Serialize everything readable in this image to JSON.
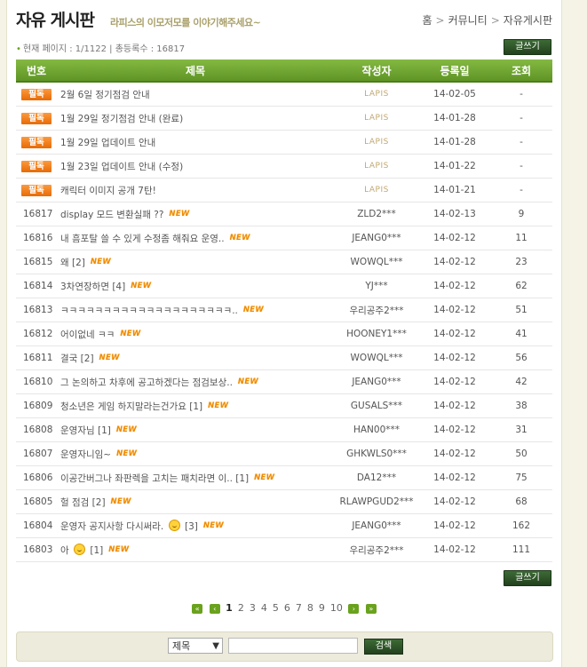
{
  "header": {
    "title": "자유 게시판",
    "subtitle": "라피스의 이모저모를 이야기해주세요~",
    "breadcrumb": [
      "홈",
      "커뮤니티",
      "자유게시판"
    ],
    "separator": ">"
  },
  "info": "현재 페이지 : 1/1122 | 총등록수 : 16817",
  "write_label": "글쓰기",
  "columns": [
    "번호",
    "제목",
    "작성자",
    "등록일",
    "조회"
  ],
  "notice_label": "필독",
  "new_label": "NEW",
  "notices": [
    {
      "title": "2월 6일 정기점검 안내",
      "author": "LAPIS",
      "date": "14-02-05",
      "views": "-"
    },
    {
      "title": "1월 29일 정기점검 안내 (완료)",
      "author": "LAPIS",
      "date": "14-01-28",
      "views": "-"
    },
    {
      "title": "1월 29일 업데이트 안내",
      "author": "LAPIS",
      "date": "14-01-28",
      "views": "-"
    },
    {
      "title": "1월 23일 업데이트 안내 (수정)",
      "author": "LAPIS",
      "date": "14-01-22",
      "views": "-"
    },
    {
      "title": "캐릭터 이미지 공개 7탄!",
      "author": "LAPIS",
      "date": "14-01-21",
      "views": "-"
    }
  ],
  "posts": [
    {
      "num": "16817",
      "title": "display 모드 변환실패 ??",
      "comments": "",
      "author": "ZLD2***",
      "date": "14-02-13",
      "views": "9"
    },
    {
      "num": "16816",
      "title": "내 흠포탈 쓸 수 있게 수정좀 해줘요 운영..",
      "comments": "",
      "author": "JEANG0***",
      "date": "14-02-12",
      "views": "11"
    },
    {
      "num": "16815",
      "title": "왜",
      "comments": "[2]",
      "author": "WOWQL***",
      "date": "14-02-12",
      "views": "23"
    },
    {
      "num": "16814",
      "title": "3차연장하면",
      "comments": "[4]",
      "author": "YJ***",
      "date": "14-02-12",
      "views": "62"
    },
    {
      "num": "16813",
      "title": "ㅋㅋㅋㅋㅋㅋㅋㅋㅋㅋㅋㅋㅋㅋㅋㅋㅋㅋㅋㅋ..",
      "comments": "",
      "author": "우리공주2***",
      "date": "14-02-12",
      "views": "51"
    },
    {
      "num": "16812",
      "title": "어이없네 ㅋㅋ",
      "comments": "",
      "author": "HOONEY1***",
      "date": "14-02-12",
      "views": "41"
    },
    {
      "num": "16811",
      "title": "결국",
      "comments": "[2]",
      "author": "WOWQL***",
      "date": "14-02-12",
      "views": "56"
    },
    {
      "num": "16810",
      "title": "그 논의하고 차후에 공고하겠다는 점검보상..",
      "comments": "",
      "author": "JEANG0***",
      "date": "14-02-12",
      "views": "42"
    },
    {
      "num": "16809",
      "title": "청소년은 게임 하지말라는건가요",
      "comments": "[1]",
      "author": "GUSALS***",
      "date": "14-02-12",
      "views": "38"
    },
    {
      "num": "16808",
      "title": "운영자님",
      "comments": "[1]",
      "author": "HAN00***",
      "date": "14-02-12",
      "views": "31"
    },
    {
      "num": "16807",
      "title": "운영자니임~",
      "comments": "",
      "author": "GHKWLS0***",
      "date": "14-02-12",
      "views": "50"
    },
    {
      "num": "16806",
      "title": "이공간버그나 좌판렉을 고치는 패치라면 이..",
      "comments": "[1]",
      "author": "DA12***",
      "date": "14-02-12",
      "views": "75"
    },
    {
      "num": "16805",
      "title": "헐 점검",
      "comments": "[2]",
      "author": "RLAWPGUD2***",
      "date": "14-02-12",
      "views": "68"
    },
    {
      "num": "16804",
      "title": "운영자 공지사항 다시써라.",
      "emoji": true,
      "comments": "[3]",
      "author": "JEANG0***",
      "date": "14-02-12",
      "views": "162"
    },
    {
      "num": "16803",
      "title": "아",
      "emoji": true,
      "comments": "[1]",
      "author": "우리공주2***",
      "date": "14-02-12",
      "views": "111"
    }
  ],
  "pager": {
    "first_icon": "double-left-icon",
    "prev_icon": "left-icon",
    "next_icon": "right-icon",
    "last_icon": "double-right-icon",
    "pages": [
      "1",
      "2",
      "3",
      "4",
      "5",
      "6",
      "7",
      "8",
      "9",
      "10"
    ],
    "current": "1"
  },
  "search": {
    "select_value": "제목",
    "input_value": "",
    "button_label": "검색"
  },
  "colors": {
    "header_green": "#6aa21e",
    "notice_orange": "#f3800f",
    "button_dark_green": "#2e5428"
  }
}
